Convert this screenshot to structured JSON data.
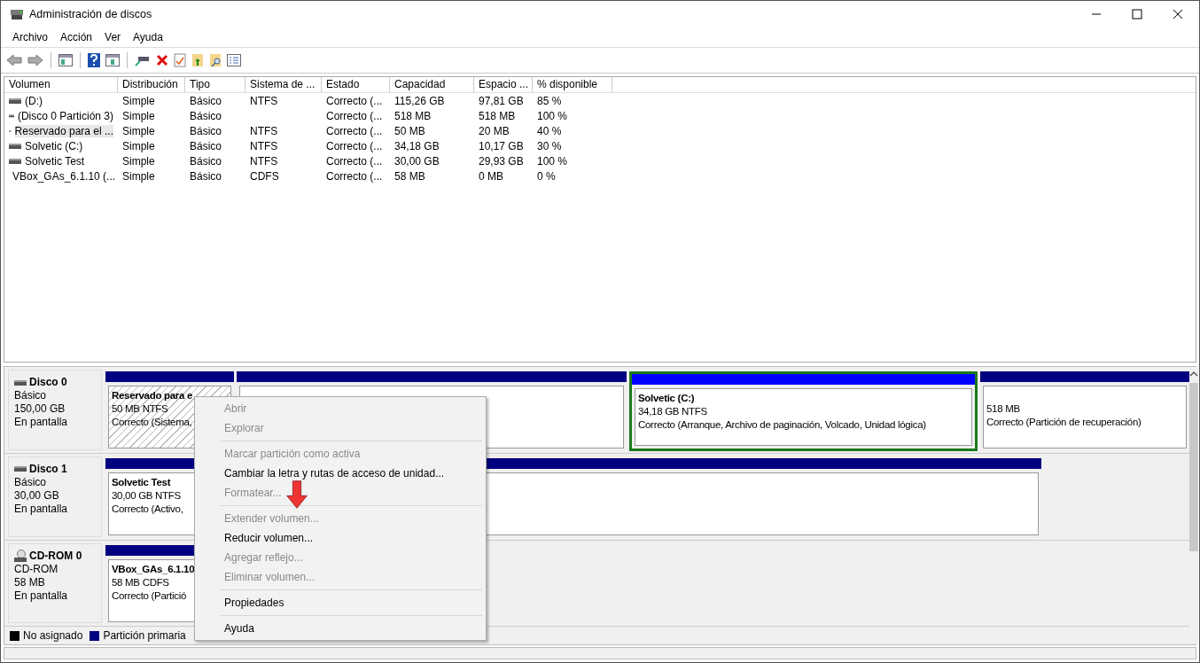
{
  "window": {
    "title": "Administración de discos"
  },
  "menu": [
    "Archivo",
    "Acción",
    "Ver",
    "Ayuda"
  ],
  "table": {
    "columns": [
      "Volumen",
      "Distribución",
      "Tipo",
      "Sistema de ...",
      "Estado",
      "Capacidad",
      "Espacio ...",
      "% disponible"
    ],
    "rows": [
      {
        "kind": "disk",
        "selected": false,
        "cells": [
          "(D:)",
          "Simple",
          "Básico",
          "NTFS",
          "Correcto (...",
          "115,26 GB",
          "97,81 GB",
          "85 %"
        ]
      },
      {
        "kind": "disk",
        "selected": false,
        "cells": [
          "(Disco 0 Partición 3)",
          "Simple",
          "Básico",
          "",
          "Correcto (...",
          "518 MB",
          "518 MB",
          "100 %"
        ]
      },
      {
        "kind": "disk",
        "selected": true,
        "cells": [
          "Reservado para el ...",
          "Simple",
          "Básico",
          "NTFS",
          "Correcto (...",
          "50 MB",
          "20 MB",
          "40 %"
        ]
      },
      {
        "kind": "disk",
        "selected": false,
        "cells": [
          "Solvetic (C:)",
          "Simple",
          "Básico",
          "NTFS",
          "Correcto (...",
          "34,18 GB",
          "10,17 GB",
          "30 %"
        ]
      },
      {
        "kind": "disk",
        "selected": false,
        "cells": [
          "Solvetic Test",
          "Simple",
          "Básico",
          "NTFS",
          "Correcto (...",
          "30,00 GB",
          "29,93 GB",
          "100 %"
        ]
      },
      {
        "kind": "cd",
        "selected": false,
        "cells": [
          "VBox_GAs_6.1.10 (...",
          "Simple",
          "Básico",
          "CDFS",
          "Correcto (...",
          "58 MB",
          "0 MB",
          "0 %"
        ]
      }
    ]
  },
  "disks": [
    {
      "kind": "disk",
      "name": "Disco 0",
      "type": "Básico",
      "size": "150,00 GB",
      "status": "En pantalla",
      "partitions": [
        {
          "kind": "reserved",
          "selected": false,
          "color": "#000080",
          "title": "Reservado para e",
          "size": "50 MB NTFS",
          "status": "Correcto (Sistema,"
        },
        {
          "kind": "primary",
          "selected": false,
          "color": "#000080"
        },
        {
          "kind": "primary",
          "selected": true,
          "color": "#0000ff",
          "title": "Solvetic  (C:)",
          "size": "34,18 GB NTFS",
          "status": "Correcto (Arranque, Archivo de paginación, Volcado, Unidad lógica)"
        },
        {
          "kind": "primary",
          "selected": false,
          "color": "#000080",
          "size": "518 MB",
          "status": "Correcto (Partición de recuperación)"
        }
      ]
    },
    {
      "kind": "disk",
      "name": "Disco 1",
      "type": "Básico",
      "size": "30,00 GB",
      "status": "En pantalla",
      "partitions": [
        {
          "kind": "primary",
          "selected": false,
          "color": "#000080",
          "title": "Solvetic Test",
          "size": "30,00 GB NTFS",
          "status": "Correcto (Activo,"
        }
      ]
    },
    {
      "kind": "cd",
      "name": "CD-ROM 0",
      "type": "CD-ROM",
      "size": "58 MB",
      "status": "En pantalla",
      "partitions": [
        {
          "kind": "primary",
          "selected": false,
          "color": "#000080",
          "title": "VBox_GAs_6.1.10",
          "size": "58 MB CDFS",
          "status": "Correcto (Partició"
        }
      ]
    }
  ],
  "legend": [
    {
      "label": "No asignado",
      "color": "#000000"
    },
    {
      "label": "Partición primaria",
      "color": "#000080"
    }
  ],
  "context_menu": [
    {
      "kind": "item",
      "label": "Abrir",
      "disabled": true
    },
    {
      "kind": "item",
      "label": "Explorar",
      "disabled": true
    },
    {
      "kind": "separator"
    },
    {
      "kind": "item",
      "label": "Marcar partición como activa",
      "disabled": true
    },
    {
      "kind": "item",
      "label": "Cambiar la letra y rutas de acceso de unidad...",
      "disabled": false
    },
    {
      "kind": "item",
      "label": "Formatear...",
      "disabled": true
    },
    {
      "kind": "separator"
    },
    {
      "kind": "item",
      "label": "Extender volumen...",
      "disabled": true
    },
    {
      "kind": "item",
      "label": "Reducir volumen...",
      "disabled": false
    },
    {
      "kind": "item",
      "label": "Agregar reflejo...",
      "disabled": true
    },
    {
      "kind": "item",
      "label": "Eliminar volumen...",
      "disabled": true
    },
    {
      "kind": "separator"
    },
    {
      "kind": "item",
      "label": "Propiedades",
      "disabled": false
    },
    {
      "kind": "separator"
    },
    {
      "kind": "item",
      "label": "Ayuda",
      "disabled": false
    }
  ]
}
